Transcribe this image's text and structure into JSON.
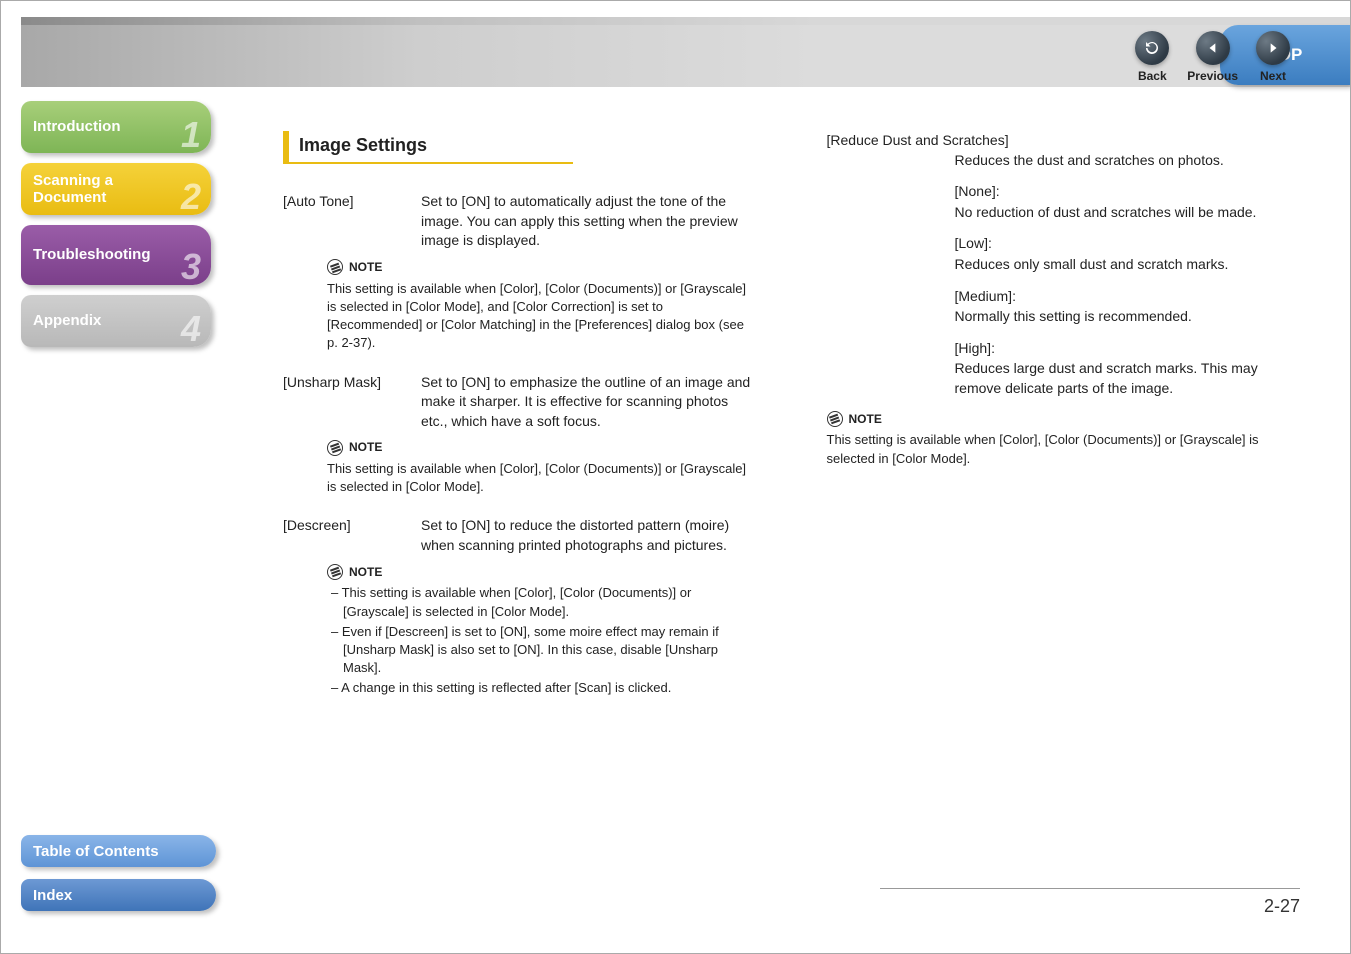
{
  "nav": {
    "back": "Back",
    "previous": "Previous",
    "next": "Next",
    "top": "TOP"
  },
  "sidebar": {
    "items": [
      {
        "label": "Introduction",
        "num": "1"
      },
      {
        "label": "Scanning a\nDocument",
        "num": "2"
      },
      {
        "label": "Troubleshooting",
        "num": "3"
      },
      {
        "label": "Appendix",
        "num": "4"
      }
    ],
    "toc": "Table of Contents",
    "index": "Index"
  },
  "heading": "Image Settings",
  "col1": {
    "autoTone": {
      "term": "[Auto Tone]",
      "desc": "Set to [ON] to automatically adjust the tone of the image. You can apply this setting when the preview image is displayed.",
      "noteLabel": "NOTE",
      "note": "This setting is available when [Color], [Color (Documents)] or [Grayscale] is selected in [Color Mode], and [Color Correction] is set to [Recommended] or [Color Matching] in the [Preferences] dialog box (see p. 2-37)."
    },
    "unsharp": {
      "term": "[Unsharp Mask]",
      "desc": "Set to [ON] to emphasize the outline of an image and make it sharper. It is effective for scanning photos etc., which have a soft focus.",
      "noteLabel": "NOTE",
      "note": "This setting is available when [Color], [Color (Documents)] or [Grayscale] is selected in [Color Mode]."
    },
    "descreen": {
      "term": "[Descreen]",
      "desc": "Set to [ON] to reduce the distorted pattern (moire) when scanning printed photographs and pictures.",
      "noteLabel": "NOTE",
      "notes": [
        "This setting is available when [Color], [Color (Documents)] or [Grayscale] is selected in [Color Mode].",
        "Even if [Descreen] is set to [ON], some moire effect may remain if [Unsharp Mask] is also set to [ON]. In this case, disable [Unsharp Mask].",
        "A change in this setting is reflected after [Scan] is clicked."
      ]
    }
  },
  "col2": {
    "reduceDust": {
      "term": "[Reduce Dust and Scratches]",
      "desc": "Reduces the dust and scratches on photos.",
      "options": [
        {
          "label": "[None]:",
          "desc": "No reduction of dust and scratches will be made."
        },
        {
          "label": "[Low]:",
          "desc": "Reduces only small dust and scratch marks."
        },
        {
          "label": "[Medium]:",
          "desc": "Normally this setting is recommended."
        },
        {
          "label": "[High]:",
          "desc": "Reduces large dust and scratch marks. This may remove delicate parts of the image."
        }
      ],
      "noteLabel": "NOTE",
      "note": "This setting is available when [Color], [Color (Documents)] or [Grayscale] is selected in [Color Mode]."
    }
  },
  "pageNumber": "2-27"
}
